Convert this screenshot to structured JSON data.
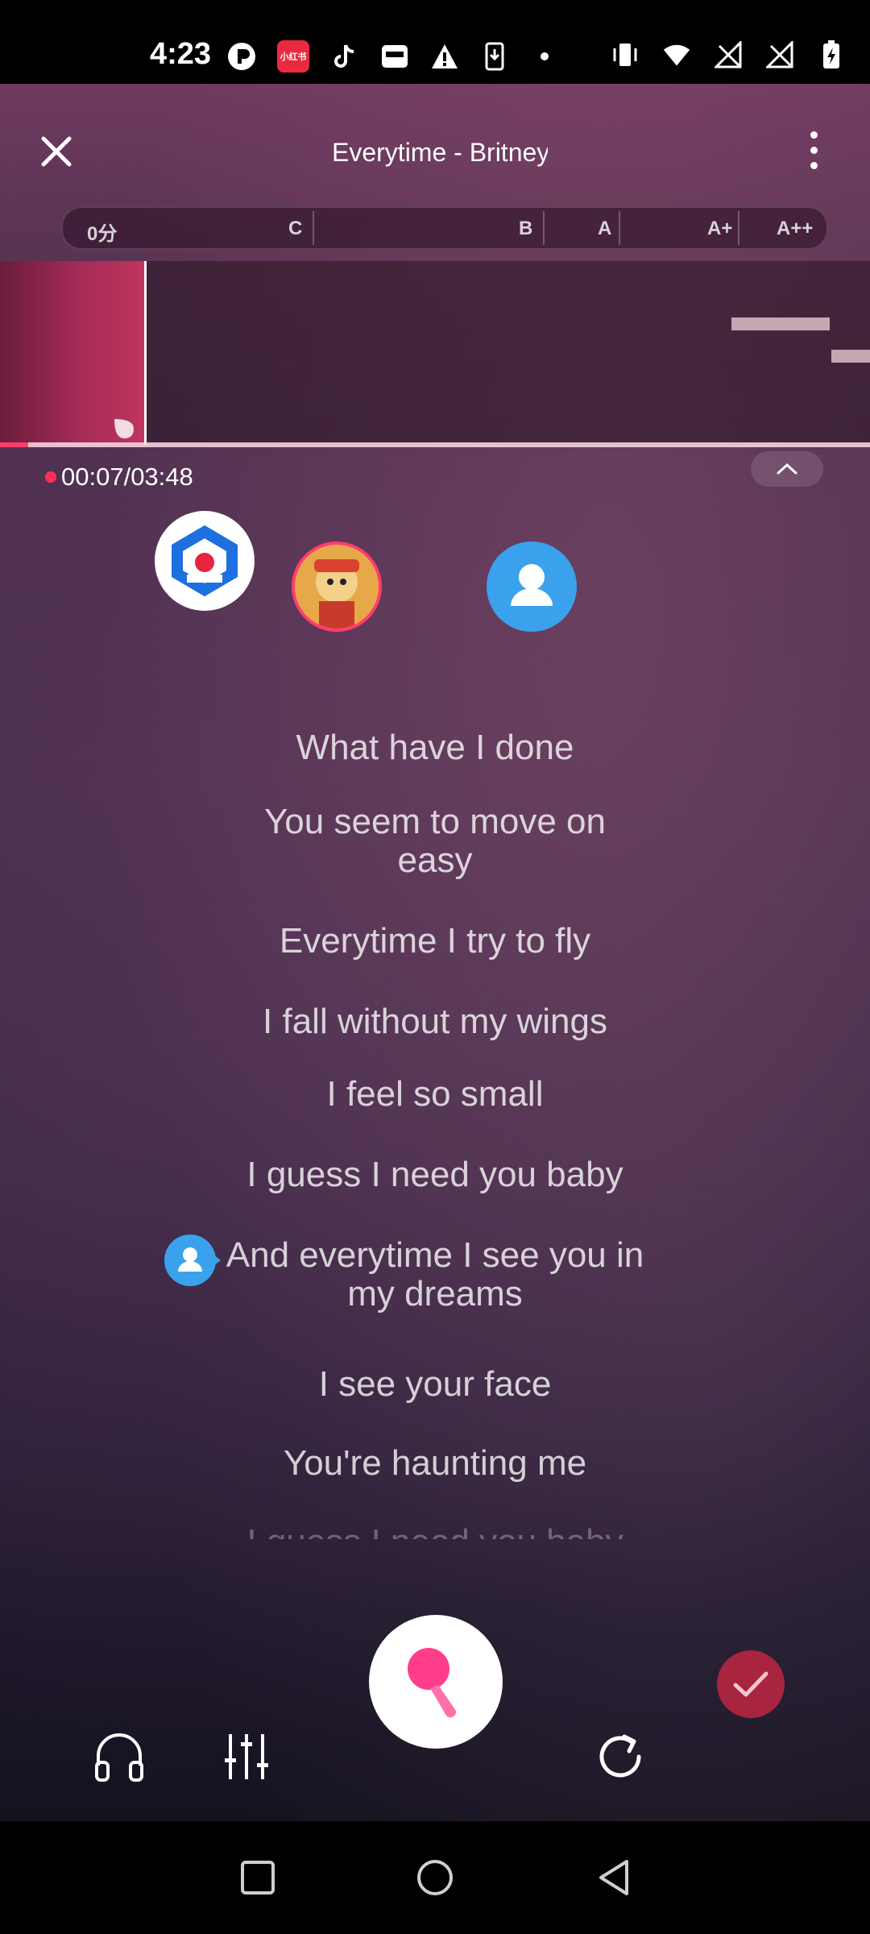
{
  "status_bar": {
    "time": "4:23",
    "left_icons": [
      "p-app-icon",
      "xiaohongshu-icon",
      "tiktok-icon",
      "inbox-icon",
      "warning-icon",
      "download-icon",
      "dot-icon"
    ],
    "xhs_label": "小红书",
    "right_icons": [
      "vibrate-icon",
      "wifi-icon",
      "signal-icon",
      "signal-icon",
      "battery-charging-icon"
    ]
  },
  "header": {
    "song_title": "Everytime - Britney Spears",
    "score_levels": {
      "zero": "0分",
      "c": "C",
      "b": "B",
      "a": "A",
      "a_plus": "A+",
      "a_plus_plus": "A++"
    }
  },
  "playback": {
    "elapsed": "00:07",
    "total": "03:48",
    "time_display": "00:07/03:48",
    "progress_fraction": 0.032
  },
  "lyrics": [
    "What have I done",
    "You seem to move on easy",
    "Everytime I try to fly",
    "I fall without my wings",
    "I feel so small",
    "I guess I need you baby",
    "And everytime I see you in my dreams",
    "I see your face",
    "You're haunting me",
    "I guess I need you baby"
  ],
  "controls": {
    "icons": [
      "headphones-icon",
      "mixer-icon",
      "microphone-icon",
      "restart-icon",
      "check-icon"
    ]
  },
  "colors": {
    "accent": "#ff3d6c",
    "done_button": "#a8243f",
    "avatar_blue": "#3aa2ec"
  },
  "nav_bar": {
    "icons": [
      "recents-icon",
      "home-icon",
      "back-icon"
    ]
  }
}
